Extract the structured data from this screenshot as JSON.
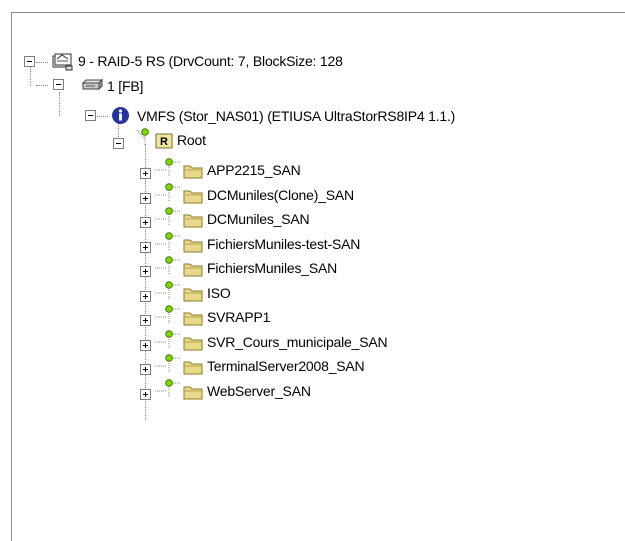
{
  "tree": {
    "raid": {
      "label": "9 - RAID-5 RS (DrvCount: 7, BlockSize: 128"
    },
    "volume": {
      "label": "1 [FB]"
    },
    "vmfs": {
      "label": "VMFS (Stor_NAS01) (ETIUSA  UltraStorRS8IP4 1.1.)"
    },
    "root": {
      "label": "Root",
      "badge": "R"
    },
    "folders": [
      {
        "label": "APP2215_SAN"
      },
      {
        "label": "DCMuniles(Clone)_SAN"
      },
      {
        "label": "DCMuniles_SAN"
      },
      {
        "label": "FichiersMuniles-test-SAN"
      },
      {
        "label": "FichiersMuniles_SAN"
      },
      {
        "label": "ISO"
      },
      {
        "label": "SVRAPP1"
      },
      {
        "label": "SVR_Cours_municipale_SAN"
      },
      {
        "label": "TerminalServer2008_SAN"
      },
      {
        "label": "WebServer_SAN"
      }
    ]
  },
  "colors": {
    "folder": "#e8d98a",
    "info_icon": "#27349e",
    "node_green": "#7fd800"
  }
}
